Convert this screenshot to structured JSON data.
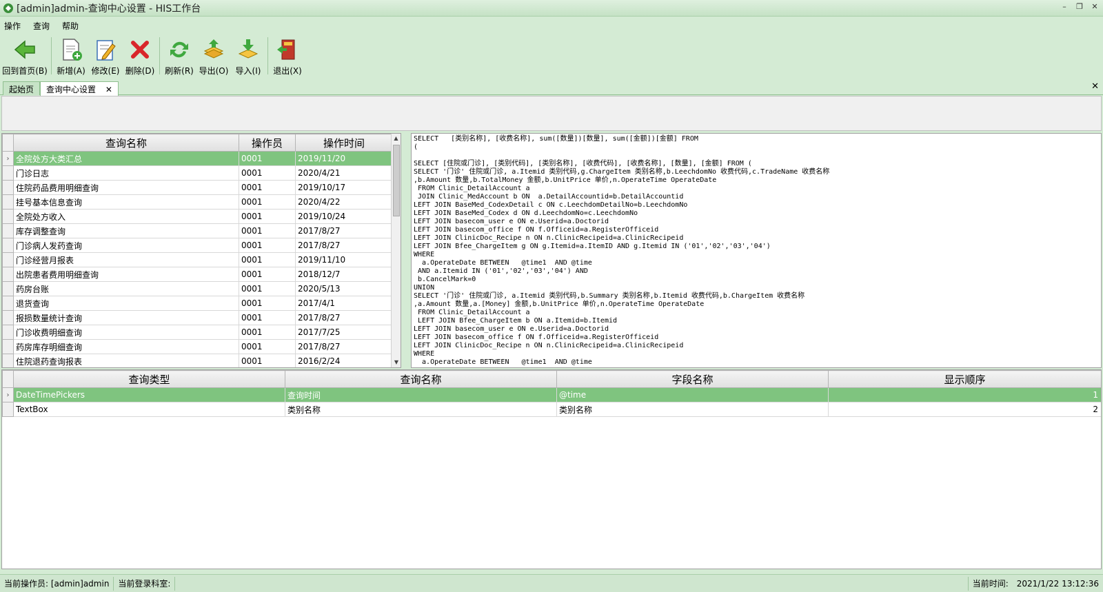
{
  "window": {
    "title": "[admin]admin-查询中心设置 - HIS工作台",
    "controls": {
      "minimize": "–",
      "restore": "❐",
      "close": "✕"
    }
  },
  "menu": [
    "操作",
    "查询",
    "帮助"
  ],
  "toolbar": [
    {
      "label": "回到首页(B)",
      "icon": "back-arrow-icon"
    },
    {
      "label": "新增(A)",
      "icon": "add-document-icon"
    },
    {
      "label": "修改(E)",
      "icon": "edit-icon"
    },
    {
      "label": "删除(D)",
      "icon": "delete-icon"
    },
    {
      "label": "刷新(R)",
      "icon": "refresh-icon"
    },
    {
      "label": "导出(O)",
      "icon": "export-icon"
    },
    {
      "label": "导入(I)",
      "icon": "import-icon"
    },
    {
      "label": "退出(X)",
      "icon": "exit-icon"
    }
  ],
  "tabs": [
    {
      "label": "起始页",
      "active": false
    },
    {
      "label": "查询中心设置",
      "active": true,
      "close": "✕"
    }
  ],
  "tabs_close": "✕",
  "query_grid": {
    "columns": [
      "查询名称",
      "操作员",
      "操作时间"
    ],
    "rows": [
      [
        "全院处方大类汇总",
        "0001",
        "2019/11/20"
      ],
      [
        "门诊日志",
        "0001",
        "2020/4/21"
      ],
      [
        "住院药品费用明细查询",
        "0001",
        "2019/10/17"
      ],
      [
        "挂号基本信息查询",
        "0001",
        "2020/4/22"
      ],
      [
        "全院处方收入",
        "0001",
        "2019/10/24"
      ],
      [
        "库存调整查询",
        "0001",
        "2017/8/27"
      ],
      [
        "门诊病人发药查询",
        "0001",
        "2017/8/27"
      ],
      [
        "门诊经营月报表",
        "0001",
        "2019/11/10"
      ],
      [
        "出院患者费用明细查询",
        "0001",
        "2018/12/7"
      ],
      [
        "药房台账",
        "0001",
        "2020/5/13"
      ],
      [
        "退货查询",
        "0001",
        "2017/4/1"
      ],
      [
        "报损数量统计查询",
        "0001",
        "2017/8/27"
      ],
      [
        "门诊收费明细查询",
        "0001",
        "2017/7/25"
      ],
      [
        "药房库存明细查询",
        "0001",
        "2017/8/27"
      ],
      [
        "住院退药查询报表",
        "0001",
        "2016/2/24"
      ]
    ],
    "selected_index": 0,
    "row_marker": "›"
  },
  "sql_text": "SELECT   [类别名称], [收费名称], sum([数量])[数量], sum([金额])[金额] FROM\n(\n\nSELECT [住院或门诊], [类别代码], [类别名称], [收费代码], [收费名称], [数量], [金额] FROM (\nSELECT '门诊' 住院或门诊, a.Itemid 类别代码,g.ChargeItem 类别名称,b.LeechdomNo 收费代码,c.TradeName 收费名称\n,b.Amount 数量,b.TotalMoney 金额,b.UnitPrice 单价,n.OperateTime OperateDate\n FROM Clinic_DetailAccount a\n JOIN Clinic_MedAccount b ON  a.DetailAccountid=b.DetailAccountid\nLEFT JOIN BaseMed_CodexDetail c ON c.LeechdomDetailNo=b.LeechdomNo\nLEFT JOIN BaseMed_Codex d ON d.LeechdomNo=c.LeechdomNo\nLEFT JOIN basecom_user e ON e.Userid=a.Doctorid\nLEFT JOIN basecom_office f ON f.Officeid=a.RegisterOfficeid\nLEFT JOIN ClinicDoc_Recipe n ON n.ClinicRecipeid=a.ClinicRecipeid\nLEFT JOIN Bfee_ChargeItem g ON g.Itemid=a.ItemID AND g.Itemid IN ('01','02','03','04')\nWHERE\n  a.OperateDate BETWEEN   @time1  AND @time\n AND a.Itemid IN ('01','02','03','04') AND\n b.CancelMark=0\nUNION\nSELECT '门诊' 住院或门诊, a.Itemid 类别代码,b.Summary 类别名称,b.Itemid 收费代码,b.ChargeItem 收费名称\n,a.Amount 数量,a.[Money] 金额,b.UnitPrice 单价,n.OperateTime OperateDate\n FROM Clinic_DetailAccount a\n LEFT JOIN Bfee_ChargeItem b ON a.Itemid=b.Itemid\nLEFT JOIN basecom_user e ON e.Userid=a.Doctorid\nLEFT JOIN basecom_office f ON f.Officeid=a.RegisterOfficeid\nLEFT JOIN ClinicDoc_Recipe n ON n.ClinicRecipeid=a.ClinicRecipeid\nWHERE\n  a.OperateDate BETWEEN   @time1  AND @time",
  "param_grid": {
    "columns": [
      "查询类型",
      "查询名称",
      "字段名称",
      "显示顺序"
    ],
    "rows": [
      [
        "DateTimePickers",
        "查询时间",
        "@time",
        "1"
      ],
      [
        "TextBox",
        "类别名称",
        "类别名称",
        "2"
      ]
    ],
    "selected_index": 0,
    "row_marker": "›"
  },
  "statusbar": {
    "operator": "当前操作员: [admin]admin",
    "department": "当前登录科室:",
    "time_label": "当前时间:",
    "time_value": "2021/1/22 13:12:36"
  },
  "colors": {
    "chrome": "#d4ebd4",
    "selected_row": "#7fc47f"
  }
}
